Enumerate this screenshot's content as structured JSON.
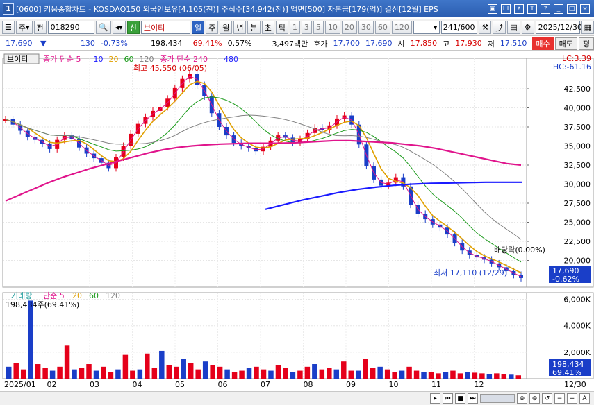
{
  "window": {
    "title": "[0600] 키움종합차트 - KOSDAQ150 외국인보유[4,105(천)] 주식수[34,942(천)] 액면[500] 자본금[179(억)] 결산[12월] EPS",
    "icon": "1"
  },
  "toolbar": {
    "market": "주",
    "prev": "전",
    "code": "018290",
    "name": "브이티",
    "new_badge": "신",
    "periods": [
      "일",
      "주",
      "월",
      "년",
      "분",
      "초",
      "틱"
    ],
    "period_selected": "일",
    "intervals": [
      "1",
      "3",
      "5",
      "10",
      "20",
      "30",
      "60",
      "120"
    ],
    "count": "241",
    "total": "/600",
    "date": "2025/12/30"
  },
  "info": {
    "price": "17,690",
    "arrow": "▼",
    "change": "130",
    "change_pct": "-0.73%",
    "volume": "198,434",
    "vol_ratio": "69.41%",
    "turnover": "0.57%",
    "amount": "3,497백만",
    "bid_label": "호가",
    "bid1": "17,700",
    "bid2": "17,690",
    "open_label": "시",
    "open": "17,850",
    "high_label": "고",
    "high": "17,930",
    "low_label": "저",
    "low": "17,510",
    "buy": "매수",
    "sell": "매도",
    "eval": "평"
  },
  "chart_data": [
    {
      "type": "line",
      "title": "브이티",
      "legend": [
        {
          "name": "종가 단순 5",
          "color": "#e0148c"
        },
        {
          "name": "10",
          "color": "#1a1aff"
        },
        {
          "name": "20",
          "color": "#e0a000"
        },
        {
          "name": "60",
          "color": "#1a9a1a"
        },
        {
          "name": "120",
          "color": "#808080"
        },
        {
          "name": "종가 단순 240",
          "color": "#e0148c"
        },
        {
          "name": "480",
          "color": "#1a1aff"
        }
      ],
      "ylim": [
        16500,
        46500
      ],
      "y_ticks": [
        20000,
        22500,
        25000,
        27500,
        30000,
        32500,
        35000,
        37500,
        40000,
        42500
      ],
      "y_tick_labels": [
        "20,000",
        "22,500",
        "25,000",
        "27,500",
        "30,000",
        "32,500",
        "35,000",
        "37,500",
        "40,000",
        "42,500"
      ],
      "x_labels": [
        "2025/01",
        "02",
        "03",
        "04",
        "05",
        "06",
        "07",
        "08",
        "09",
        "10",
        "11",
        "12",
        "12/30"
      ],
      "annotations": {
        "high": "최고 45,550 (06/05)",
        "low": "최저 17,110 (12/29)",
        "dividend": "배당락(0.00%)",
        "lc": "LC:3.39",
        "hc": "HC:-61.16",
        "last_price": "17,690",
        "last_pct": "-0.62%"
      },
      "close": [
        38500,
        37800,
        37000,
        36200,
        35800,
        35300,
        34600,
        35800,
        36400,
        35900,
        34800,
        34000,
        33400,
        32800,
        32100,
        33500,
        35000,
        36600,
        37900,
        38800,
        39600,
        40100,
        41200,
        42600,
        43800,
        44500,
        43000,
        41500,
        39300,
        37500,
        36400,
        35400,
        35000,
        34700,
        34300,
        34900,
        35700,
        36400,
        36100,
        35400,
        35900,
        36700,
        37400,
        37100,
        37700,
        38600,
        39000,
        37800,
        35200,
        32400,
        30600,
        29800,
        30200,
        30900,
        29700,
        27300,
        26100,
        25400,
        24700,
        24300,
        23400,
        22300,
        21300,
        20700,
        20400,
        20100,
        19600,
        19100,
        18600,
        18100,
        17690
      ],
      "ma240": [
        27800,
        28600,
        29400,
        30200,
        30900,
        31500,
        32100,
        32600,
        33100,
        33600,
        34100,
        34500,
        34800,
        35000,
        35150,
        35250,
        35300,
        35350,
        35350,
        35350,
        35400,
        35500,
        35600,
        35700,
        35700,
        35600,
        35500,
        35400,
        35200,
        35000,
        34700,
        34300,
        33900,
        33500,
        33100,
        32700,
        32500
      ],
      "ma480": [
        26700,
        27300,
        27900,
        28400,
        28900,
        29300,
        29600,
        29850,
        30000,
        30100,
        30150,
        30200,
        30250,
        30250,
        30250
      ]
    },
    {
      "type": "bar",
      "title": "거래량",
      "legend": [
        {
          "name": "단순 5",
          "color": "#e0148c"
        },
        {
          "name": "20",
          "color": "#e0a000"
        },
        {
          "name": "60",
          "color": "#1a9a1a"
        },
        {
          "name": "120",
          "color": "#808080"
        }
      ],
      "current": "198,434주(69.41%)",
      "ylim": [
        0,
        6500
      ],
      "y_ticks": [
        2000,
        4000,
        6000
      ],
      "y_tick_labels": [
        "2,000K",
        "4,000K",
        "6,000K"
      ],
      "last_volume": "198,434",
      "last_pct": "69.41%",
      "values": [
        900,
        1200,
        700,
        5900,
        1100,
        800,
        600,
        900,
        2500,
        700,
        800,
        1100,
        600,
        900,
        500,
        700,
        1800,
        600,
        700,
        1900,
        800,
        2100,
        1000,
        900,
        1500,
        1200,
        700,
        1300,
        1000,
        900,
        700,
        500,
        600,
        800,
        900,
        700,
        600,
        1000,
        800,
        500,
        600,
        900,
        1100,
        700,
        800,
        700,
        1300,
        600,
        600,
        1500,
        800,
        900,
        700,
        500,
        600,
        900,
        600,
        500,
        500,
        400,
        500,
        600,
        400,
        500,
        450,
        400,
        350,
        400,
        350,
        300,
        250
      ]
    }
  ]
}
